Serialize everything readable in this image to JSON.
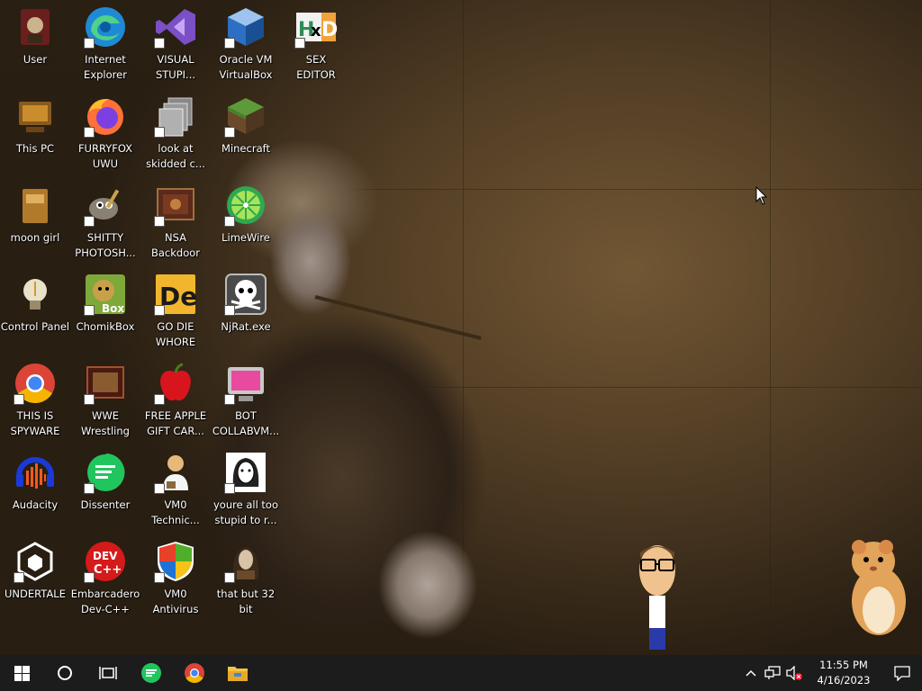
{
  "desktop_icons": [
    {
      "name": "icon-user",
      "label": "User"
    },
    {
      "name": "icon-internet-explorer",
      "label": "Internet\nExplorer"
    },
    {
      "name": "icon-visual-studio",
      "label": "VISUAL\nSTUPI..."
    },
    {
      "name": "icon-virtualbox",
      "label": "Oracle VM\nVirtualBox"
    },
    {
      "name": "icon-hex-editor",
      "label": "SEX\nEDITOR"
    },
    {
      "name": "icon-this-pc",
      "label": "This PC"
    },
    {
      "name": "icon-firefox",
      "label": "FURRYFOX\nUWU"
    },
    {
      "name": "icon-skidded",
      "label": "look at\nskidded c..."
    },
    {
      "name": "icon-minecraft",
      "label": "Minecraft"
    },
    {
      "name": "icon-moon-girl",
      "label": "moon girl"
    },
    {
      "name": "icon-gimp",
      "label": "SHITTY\nPHOTOSH..."
    },
    {
      "name": "icon-nsa-backdoor",
      "label": "NSA\nBackdoor"
    },
    {
      "name": "icon-limewire",
      "label": "LimeWire"
    },
    {
      "name": "icon-control-panel",
      "label": "Control Panel"
    },
    {
      "name": "icon-chomikbox",
      "label": "ChomikBox"
    },
    {
      "name": "icon-go-die",
      "label": "GO DIE\nWHORE"
    },
    {
      "name": "icon-njrat",
      "label": "NjRat.exe"
    },
    {
      "name": "icon-chrome",
      "label": "THIS IS\nSPYWARE"
    },
    {
      "name": "icon-wwe",
      "label": "WWE\nWrestling"
    },
    {
      "name": "icon-free-apple",
      "label": "FREE APPLE\nGIFT CAR..."
    },
    {
      "name": "icon-bot-collabvm",
      "label": "BOT\nCOLLABVM..."
    },
    {
      "name": "icon-audacity",
      "label": "Audacity"
    },
    {
      "name": "icon-dissenter",
      "label": "Dissenter"
    },
    {
      "name": "icon-vm0-technic",
      "label": "VM0\nTechnic..."
    },
    {
      "name": "icon-youre-all",
      "label": "youre all too\nstupid to r..."
    },
    {
      "name": "icon-undertale",
      "label": "UNDERTALE"
    },
    {
      "name": "icon-devcpp",
      "label": "Embarcadero\nDev-C++"
    },
    {
      "name": "icon-vm0-antivirus",
      "label": "VM0\nAntivirus"
    },
    {
      "name": "icon-that-but-32bit",
      "label": "that but 32\nbit"
    }
  ],
  "icon_glyphs": {
    "devcpp": "DEV\nC++",
    "chomikbox": "Box",
    "go_die": "De",
    "hexed": "HxD"
  },
  "taskbar": {
    "clock_time": "11:55 PM",
    "clock_date": "4/16/2023"
  },
  "colors": {
    "taskbar_bg": "#1c1c1c",
    "accent": "#0078d7"
  }
}
